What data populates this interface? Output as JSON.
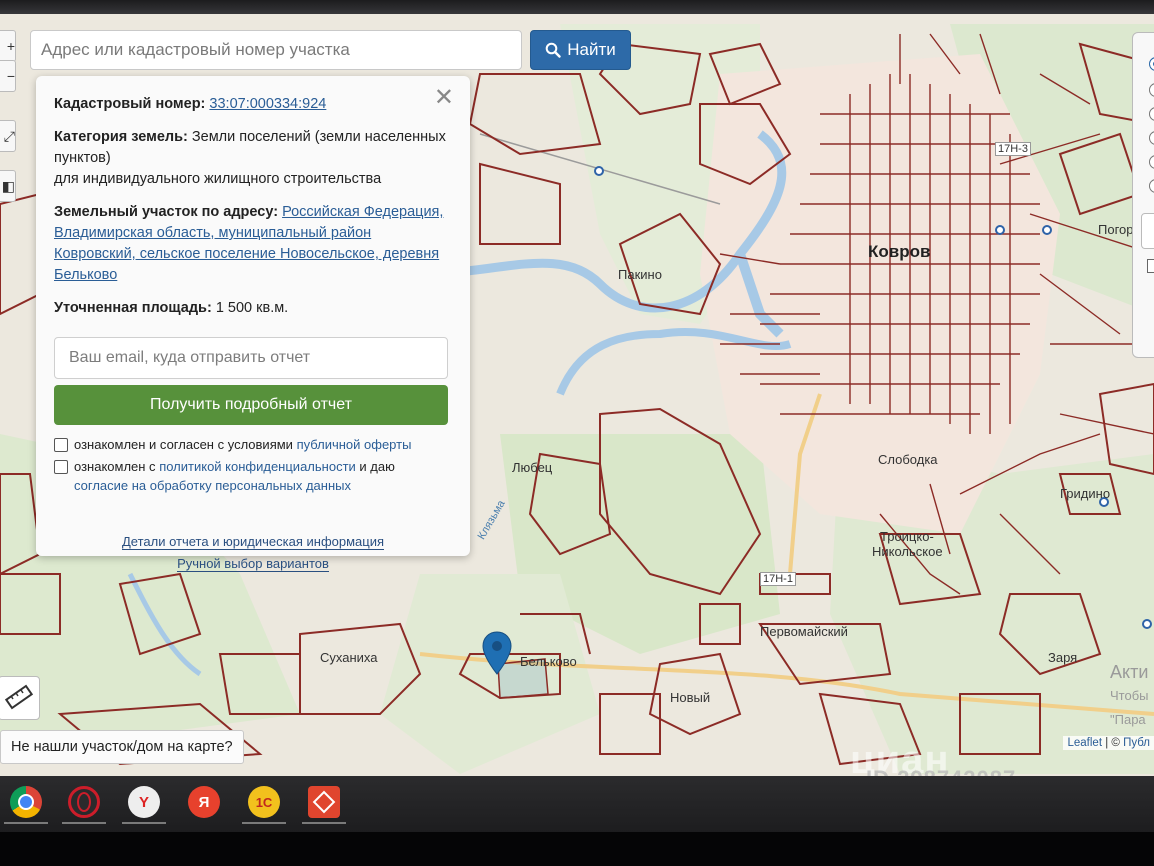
{
  "search": {
    "placeholder": "Адрес или кадастровый номер участка",
    "button_label": "Найти"
  },
  "popup": {
    "cadastral_label": "Кадастровый номер:",
    "cadastral_value": "33:07:000334:924",
    "category_label": "Категория земель:",
    "category_value": "Земли поселений (земли населенных пунктов)",
    "usage": "для индивидуального жилищного строительства",
    "address_label": "Земельный участок по адресу:",
    "address_value": "Российская Федерация, Владимирская область, муниципальный район Ковровский, сельское поселение Новосельское, деревня Бельково",
    "area_label": "Уточненная площадь:",
    "area_value": "1 500 кв.м.",
    "email_placeholder": "Ваш email, куда отправить отчет",
    "report_button": "Получить подробный отчет",
    "consent1_prefix": "ознакомлен и согласен с условиями",
    "consent1_link": "публичной оферты",
    "consent2_prefix": "ознакомлен с",
    "consent2_link": "политикой конфиденциальности",
    "consent2_mid": "и даю",
    "consent2_link2": "согласие на обработку персональных данных",
    "details_link": "Детали отчета и юридическая информация",
    "manual_link": "Ручной выбор вариантов"
  },
  "map_labels": {
    "city": "Ковров",
    "places": [
      "Пакино",
      "Любец",
      "Суханиха",
      "Бельково",
      "Новый",
      "Первомайский",
      "Троицко-",
      "Никольское",
      "Гридино",
      "Заря",
      "Погорел",
      "Слободка"
    ],
    "road_1": "17Н-3",
    "road_2": "17Н-1",
    "river": "Клязьма"
  },
  "controls": {
    "not_found": "Не нашли участок/дом на карте?",
    "attribution_leaflet": "Leaflet",
    "attribution_sep": " | © ",
    "attribution_rest": "Публ"
  },
  "overlays": {
    "watermark": "циан",
    "watermark_id": "ID 298742087",
    "activation_title": "Акти",
    "activation_line2": "Чтобы",
    "activation_line3": "\"Пара"
  },
  "taskbar": {
    "apps": [
      {
        "icon": "chrome-icon",
        "color": "#dd4b3e"
      },
      {
        "icon": "opera-icon",
        "color": "#cc1d2a"
      },
      {
        "icon": "yandex-browser-icon",
        "color": "#e6e6e6",
        "glyph": "Y"
      },
      {
        "icon": "yandex-icon",
        "color": "#e7412d",
        "glyph": "Я"
      },
      {
        "icon": "1c-icon",
        "color": "#f2c11d",
        "glyph": "1С"
      },
      {
        "icon": "anydesk-icon",
        "color": "#e0452e"
      }
    ]
  },
  "colors": {
    "parcel": "#8c2b26",
    "accent_blue": "#2d6aa8",
    "button_green": "#57913b",
    "marker": "#1f6fb3"
  }
}
